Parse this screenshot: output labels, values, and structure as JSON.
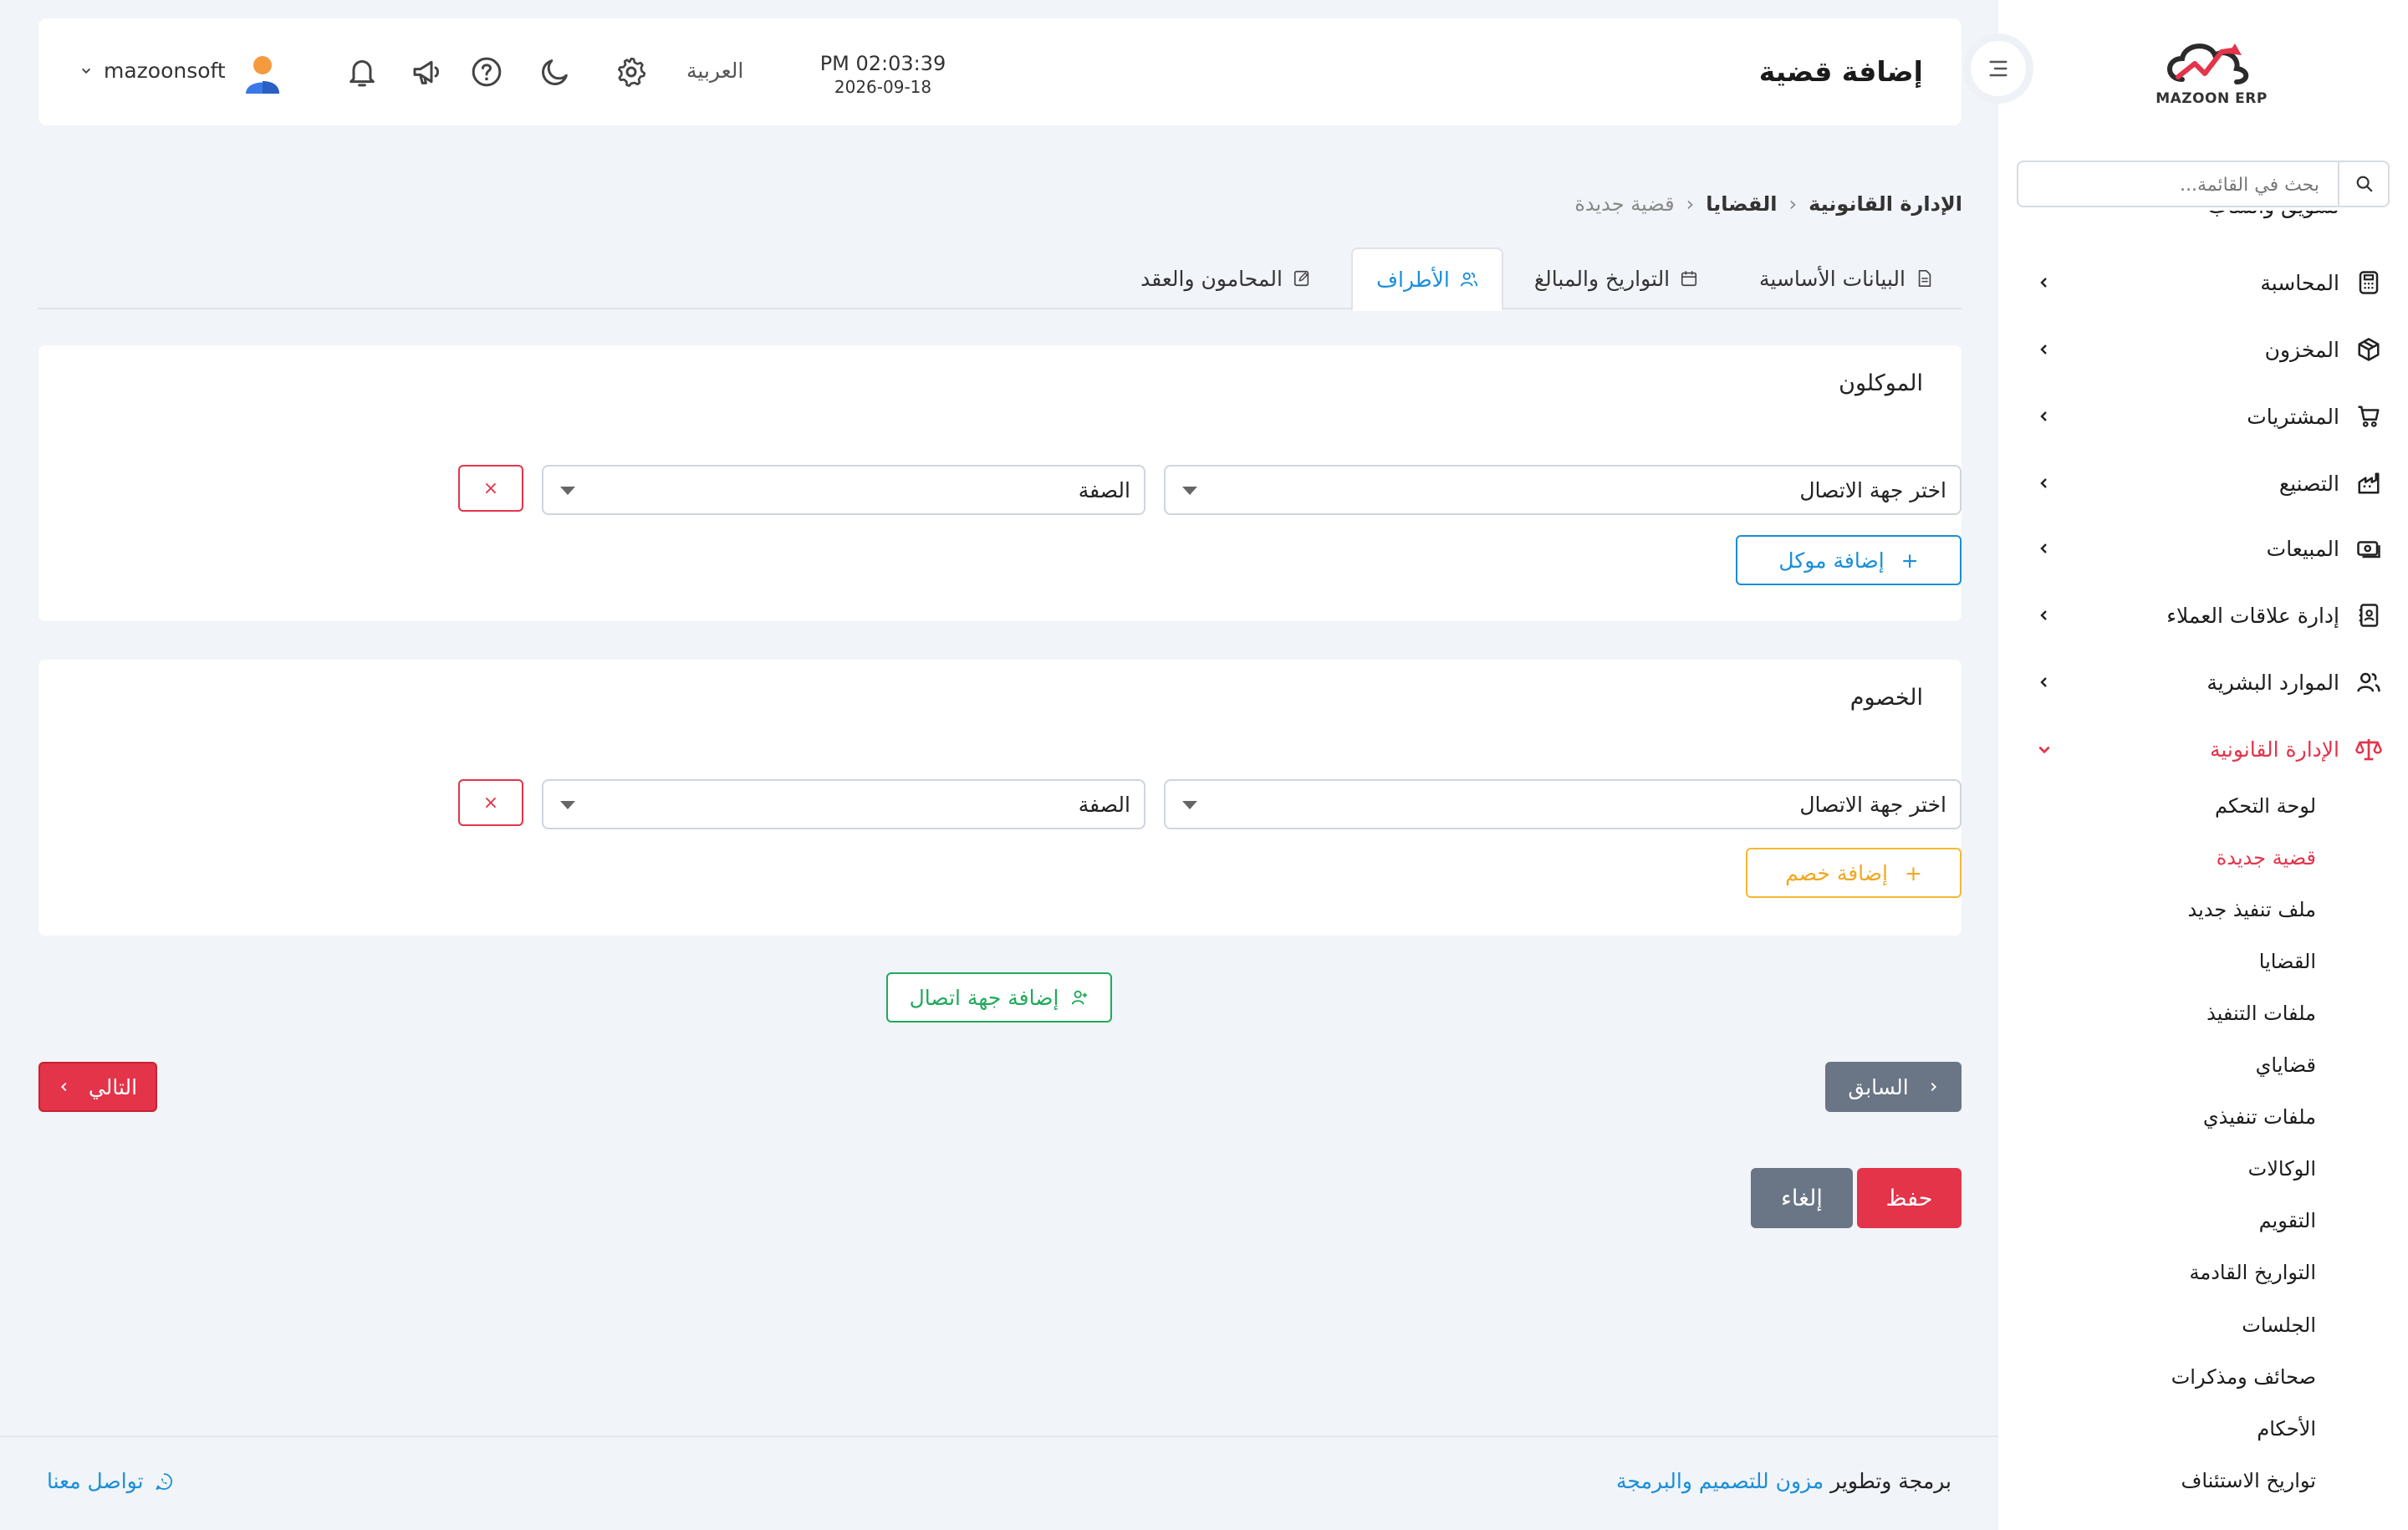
{
  "app": {
    "logo_text": "MAZOON ERP",
    "accent_color": "#e3344a",
    "link_color": "#1a8ed8"
  },
  "sidebar": {
    "search_placeholder": "بحث في القائمة...",
    "partial_item": "تسويق واتساب",
    "items": [
      {
        "label": "المحاسبة",
        "icon": "calculator-icon"
      },
      {
        "label": "المخزون",
        "icon": "box-icon"
      },
      {
        "label": "المشتريات",
        "icon": "cart-icon"
      },
      {
        "label": "التصنيع",
        "icon": "factory-icon"
      },
      {
        "label": "المبيعات",
        "icon": "cash-icon"
      },
      {
        "label": "إدارة علاقات العملاء",
        "icon": "contacts-book-icon"
      },
      {
        "label": "الموارد البشرية",
        "icon": "users-icon"
      },
      {
        "label": "الإدارة القانونية",
        "icon": "scale-icon"
      }
    ],
    "subitems": [
      "لوحة التحكم",
      "قضية جديدة",
      "ملف تنفيذ جديد",
      "القضايا",
      "ملفات التنفيذ",
      "قضاياي",
      "ملفات تنفيذي",
      "الوكالات",
      "التقويم",
      "التواريخ القادمة",
      "الجلسات",
      "صحائف ومذكرات",
      "الأحكام",
      "تواريخ الاستئناف"
    ]
  },
  "header": {
    "title": "إضافة قضية",
    "time": "PM 02:03:39",
    "date": "2026-09-18",
    "language": "العربية",
    "username": "mazoonsoft"
  },
  "breadcrumb": {
    "root": "الإدارة القانونية",
    "parent": "القضايا",
    "current": "قضية جديدة",
    "separator": "‹"
  },
  "tabs": [
    {
      "label": "البيانات الأساسية"
    },
    {
      "label": "التواريخ والمبالغ"
    },
    {
      "label": "الأطراف"
    },
    {
      "label": "المحامون والعقد"
    }
  ],
  "clients": {
    "title": "الموكلون",
    "contact_placeholder": "اختر جهة الاتصال",
    "role_placeholder": "الصفة",
    "remove": "×",
    "add_label": "إضافة موكل"
  },
  "opponents": {
    "title": "الخصوم",
    "contact_placeholder": "اختر جهة الاتصال",
    "role_placeholder": "الصفة",
    "remove": "×",
    "add_label": "إضافة خصم"
  },
  "actions": {
    "add_contact": "إضافة جهة اتصال",
    "previous": "السابق",
    "next": "التالي",
    "save": "حفظ",
    "cancel": "إلغاء"
  },
  "footer": {
    "contact_us": "تواصل معنا",
    "credit_prefix": "برمجة وتطوير",
    "credit_link": "مزون للتصميم والبرمجة"
  }
}
